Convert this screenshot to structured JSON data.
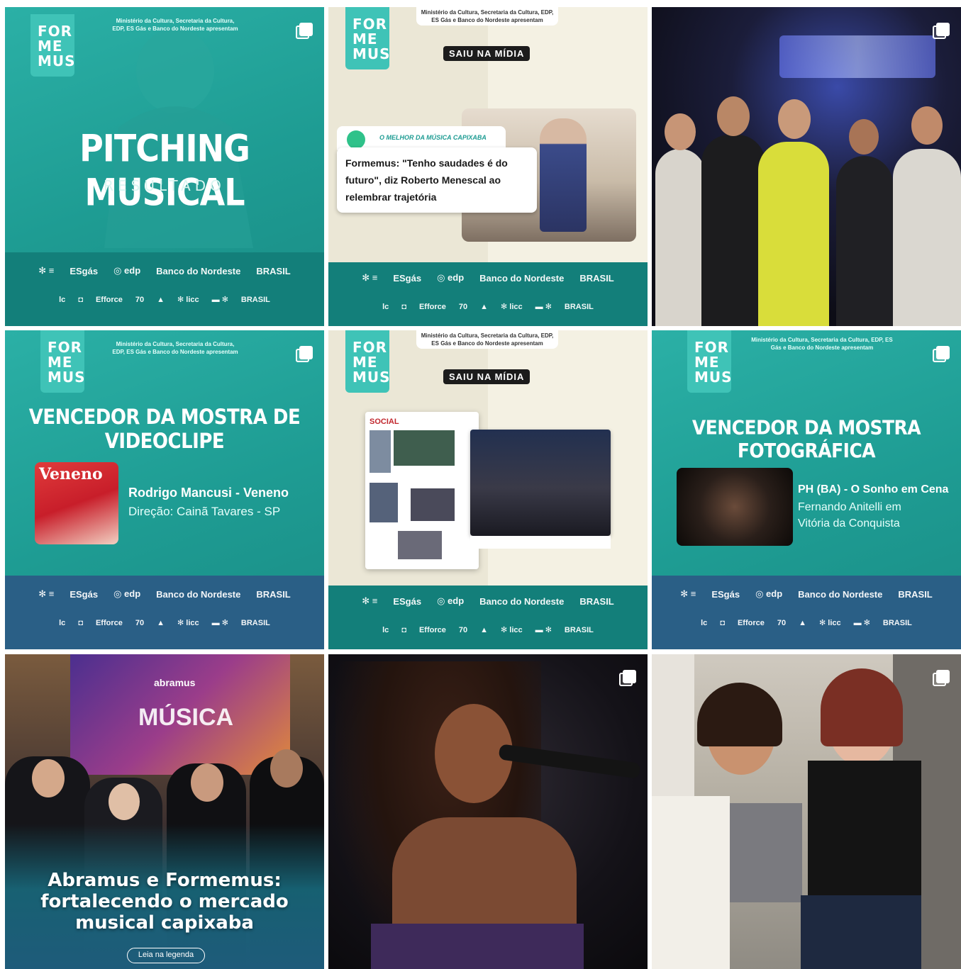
{
  "posts": [
    {
      "id": "pitching",
      "logo": [
        "FOR",
        "ME",
        "MUS"
      ],
      "ministry": "Ministério da Cultura, Secretaria da Cultura,\nEDP, ES Gás e Banco do Nordeste apresentam",
      "title": "PITCHING MUSICAL",
      "subtitle": "RESULTADO",
      "footer_row1": [
        "✻ ≡",
        "ESgás",
        "◎ edp",
        "Banco do Nordeste",
        "BRASIL"
      ],
      "footer_row2": [
        "lc",
        "◘",
        "Efforce",
        "70",
        "▲",
        "✻ licc",
        "▬ ✻",
        "BRASIL"
      ]
    },
    {
      "id": "saiu-midia-1",
      "logo": [
        "FOR",
        "ME",
        "MUS"
      ],
      "ministry": "Ministério da Cultura, Secretaria da Cultura,\nEDP, ES Gás e Banco do Nordeste apresentam",
      "badge": "SAIU NA MÍDIA",
      "tag": "O MELHOR DA MÚSICA CAPIXABA",
      "headline": "Formemus: \"Tenho saudades é do futuro\", diz Roberto Menescal ao relembrar trajetória",
      "footer_row1": [
        "✻ ≡",
        "ESgás",
        "◎ edp",
        "Banco do Nordeste",
        "BRASIL"
      ],
      "footer_row2": [
        "lc",
        "◘",
        "Efforce",
        "70",
        "▲",
        "✻ licc",
        "▬ ✻",
        "BRASIL"
      ]
    },
    {
      "id": "concert-photo"
    },
    {
      "id": "videoclipe",
      "logo": [
        "FOR",
        "ME",
        "MUS"
      ],
      "ministry": "Ministério da Cultura, Secretaria da Cultura,\nEDP, ES Gás e Banco do Nordeste apresentam",
      "title": "VENCEDOR DA MOSTRA DE VIDEOCLIPE",
      "thumb_text": "Veneno",
      "winner": "Rodrigo Mancusi - Veneno",
      "credit": "Direção: Cainã Tavares - SP",
      "footer_row1": [
        "✻ ≡",
        "ESgás",
        "◎ edp",
        "Banco do Nordeste",
        "BRASIL"
      ],
      "footer_row2": [
        "lc",
        "◘",
        "Efforce",
        "70",
        "▲",
        "✻ licc",
        "▬ ✻",
        "BRASIL"
      ]
    },
    {
      "id": "saiu-midia-2",
      "logo": [
        "FOR",
        "ME",
        "MUS"
      ],
      "ministry": "Ministério da Cultura, Secretaria da Cultura,\nEDP, ES Gás e Banco do Nordeste apresentam",
      "badge": "SAIU NA MÍDIA",
      "paper_header": "SOCIAL",
      "footer_row1": [
        "✻ ≡",
        "ESgás",
        "◎ edp",
        "Banco do Nordeste",
        "BRASIL"
      ],
      "footer_row2": [
        "lc",
        "◘",
        "Efforce",
        "70",
        "▲",
        "✻ licc",
        "▬ ✻",
        "BRASIL"
      ]
    },
    {
      "id": "fotografica",
      "logo": [
        "FOR",
        "ME",
        "MUS"
      ],
      "ministry": "Ministério da Cultura, Secretaria da Cultura,\nEDP, ES Gás e Banco do Nordeste apresentam",
      "title": "VENCEDOR DA MOSTRA FOTOGRÁFICA",
      "winner": "PH (BA) - O Sonho em Cena",
      "credit_lines": [
        "Fernando Anitelli em",
        "Vitória da Conquista"
      ],
      "footer_row1": [
        "✻ ≡",
        "ESgás",
        "◎ edp",
        "Banco do Nordeste",
        "BRASIL"
      ],
      "footer_row2": [
        "lc",
        "◘",
        "Efforce",
        "70",
        "▲",
        "✻ licc",
        "▬ ✻",
        "BRASIL"
      ]
    },
    {
      "id": "abramus",
      "banner_brand": "abramus",
      "banner_text": "MÚSICA",
      "title_lines": [
        "Abramus e Formemus:",
        "fortalecendo o mercado",
        "musical capixaba"
      ],
      "cta": "Leia na legenda"
    },
    {
      "id": "singer-photo"
    },
    {
      "id": "friends-photo"
    }
  ],
  "colors": {
    "teal": "#1e9c93",
    "teal_footer": "#137f7a",
    "blue_footer": "#2a5f86",
    "cream": "#f4f1e3",
    "logo": "#3fc3b7"
  },
  "icons": {
    "multi_post": "carousel-icon"
  }
}
